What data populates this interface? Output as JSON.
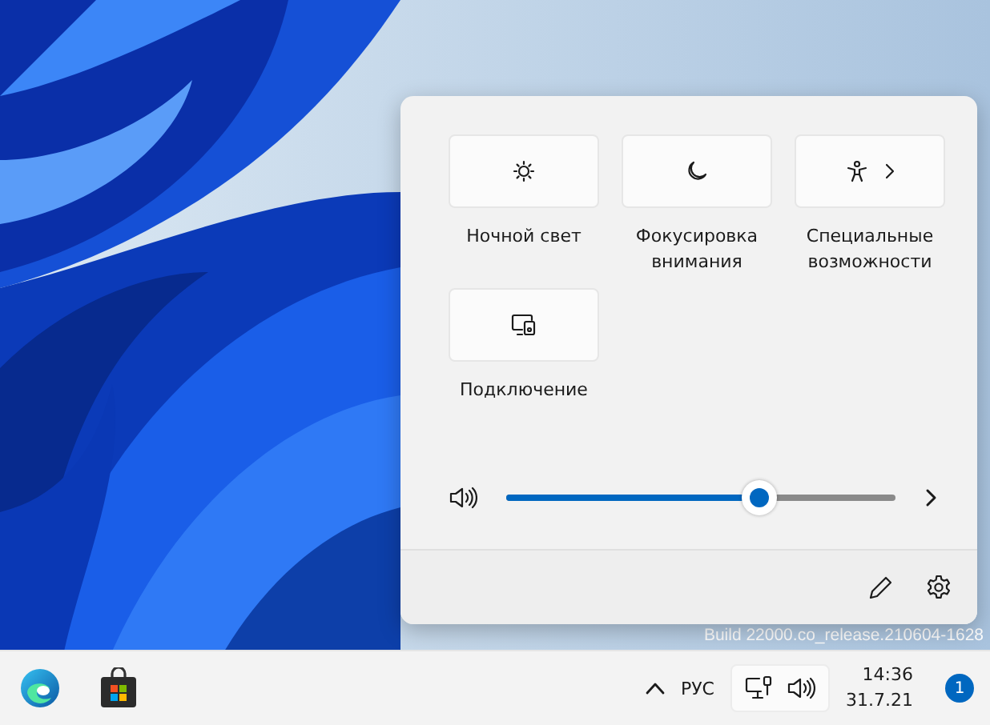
{
  "desktop": {
    "build_text": "Build 22000.co_release.210604-1628"
  },
  "quick_settings": {
    "tiles": [
      {
        "label": "Ночной свет",
        "kind": "night-light",
        "on": false
      },
      {
        "label": "Фокусировка внимания",
        "kind": "focus",
        "on": false
      },
      {
        "label": "Специальные возможности",
        "kind": "accessibility",
        "on": false
      },
      {
        "label": "Подключение",
        "kind": "cast",
        "on": false
      }
    ],
    "volume": {
      "level": 0.65
    }
  },
  "taskbar": {
    "apps": [
      {
        "kind": "edge"
      },
      {
        "kind": "store"
      }
    ],
    "language": "РУС",
    "time": "14:36",
    "date": "31.7.21",
    "notification_count": "1"
  }
}
